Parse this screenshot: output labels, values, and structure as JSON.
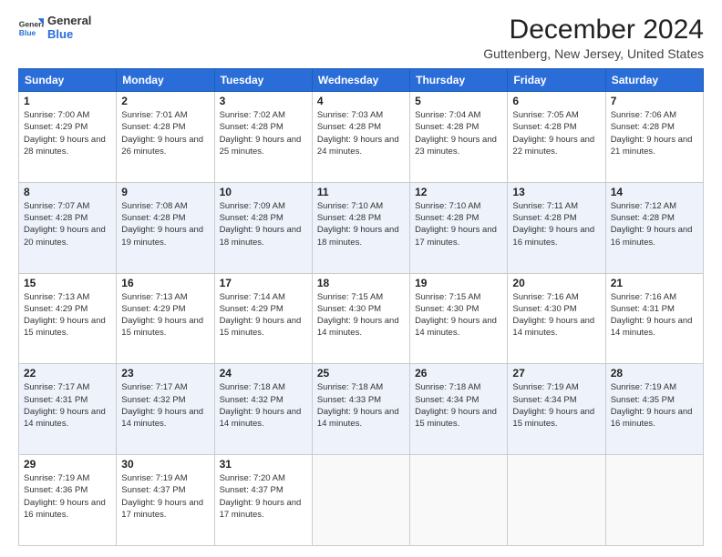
{
  "logo": {
    "text_general": "General",
    "text_blue": "Blue"
  },
  "header": {
    "title": "December 2024",
    "subtitle": "Guttenberg, New Jersey, United States"
  },
  "weekdays": [
    "Sunday",
    "Monday",
    "Tuesday",
    "Wednesday",
    "Thursday",
    "Friday",
    "Saturday"
  ],
  "weeks": [
    [
      {
        "day": "1",
        "sunrise": "7:00 AM",
        "sunset": "4:29 PM",
        "daylight": "9 hours and 28 minutes."
      },
      {
        "day": "2",
        "sunrise": "7:01 AM",
        "sunset": "4:28 PM",
        "daylight": "9 hours and 26 minutes."
      },
      {
        "day": "3",
        "sunrise": "7:02 AM",
        "sunset": "4:28 PM",
        "daylight": "9 hours and 25 minutes."
      },
      {
        "day": "4",
        "sunrise": "7:03 AM",
        "sunset": "4:28 PM",
        "daylight": "9 hours and 24 minutes."
      },
      {
        "day": "5",
        "sunrise": "7:04 AM",
        "sunset": "4:28 PM",
        "daylight": "9 hours and 23 minutes."
      },
      {
        "day": "6",
        "sunrise": "7:05 AM",
        "sunset": "4:28 PM",
        "daylight": "9 hours and 22 minutes."
      },
      {
        "day": "7",
        "sunrise": "7:06 AM",
        "sunset": "4:28 PM",
        "daylight": "9 hours and 21 minutes."
      }
    ],
    [
      {
        "day": "8",
        "sunrise": "7:07 AM",
        "sunset": "4:28 PM",
        "daylight": "9 hours and 20 minutes."
      },
      {
        "day": "9",
        "sunrise": "7:08 AM",
        "sunset": "4:28 PM",
        "daylight": "9 hours and 19 minutes."
      },
      {
        "day": "10",
        "sunrise": "7:09 AM",
        "sunset": "4:28 PM",
        "daylight": "9 hours and 18 minutes."
      },
      {
        "day": "11",
        "sunrise": "7:10 AM",
        "sunset": "4:28 PM",
        "daylight": "9 hours and 18 minutes."
      },
      {
        "day": "12",
        "sunrise": "7:10 AM",
        "sunset": "4:28 PM",
        "daylight": "9 hours and 17 minutes."
      },
      {
        "day": "13",
        "sunrise": "7:11 AM",
        "sunset": "4:28 PM",
        "daylight": "9 hours and 16 minutes."
      },
      {
        "day": "14",
        "sunrise": "7:12 AM",
        "sunset": "4:28 PM",
        "daylight": "9 hours and 16 minutes."
      }
    ],
    [
      {
        "day": "15",
        "sunrise": "7:13 AM",
        "sunset": "4:29 PM",
        "daylight": "9 hours and 15 minutes."
      },
      {
        "day": "16",
        "sunrise": "7:13 AM",
        "sunset": "4:29 PM",
        "daylight": "9 hours and 15 minutes."
      },
      {
        "day": "17",
        "sunrise": "7:14 AM",
        "sunset": "4:29 PM",
        "daylight": "9 hours and 15 minutes."
      },
      {
        "day": "18",
        "sunrise": "7:15 AM",
        "sunset": "4:30 PM",
        "daylight": "9 hours and 14 minutes."
      },
      {
        "day": "19",
        "sunrise": "7:15 AM",
        "sunset": "4:30 PM",
        "daylight": "9 hours and 14 minutes."
      },
      {
        "day": "20",
        "sunrise": "7:16 AM",
        "sunset": "4:30 PM",
        "daylight": "9 hours and 14 minutes."
      },
      {
        "day": "21",
        "sunrise": "7:16 AM",
        "sunset": "4:31 PM",
        "daylight": "9 hours and 14 minutes."
      }
    ],
    [
      {
        "day": "22",
        "sunrise": "7:17 AM",
        "sunset": "4:31 PM",
        "daylight": "9 hours and 14 minutes."
      },
      {
        "day": "23",
        "sunrise": "7:17 AM",
        "sunset": "4:32 PM",
        "daylight": "9 hours and 14 minutes."
      },
      {
        "day": "24",
        "sunrise": "7:18 AM",
        "sunset": "4:32 PM",
        "daylight": "9 hours and 14 minutes."
      },
      {
        "day": "25",
        "sunrise": "7:18 AM",
        "sunset": "4:33 PM",
        "daylight": "9 hours and 14 minutes."
      },
      {
        "day": "26",
        "sunrise": "7:18 AM",
        "sunset": "4:34 PM",
        "daylight": "9 hours and 15 minutes."
      },
      {
        "day": "27",
        "sunrise": "7:19 AM",
        "sunset": "4:34 PM",
        "daylight": "9 hours and 15 minutes."
      },
      {
        "day": "28",
        "sunrise": "7:19 AM",
        "sunset": "4:35 PM",
        "daylight": "9 hours and 16 minutes."
      }
    ],
    [
      {
        "day": "29",
        "sunrise": "7:19 AM",
        "sunset": "4:36 PM",
        "daylight": "9 hours and 16 minutes."
      },
      {
        "day": "30",
        "sunrise": "7:19 AM",
        "sunset": "4:37 PM",
        "daylight": "9 hours and 17 minutes."
      },
      {
        "day": "31",
        "sunrise": "7:20 AM",
        "sunset": "4:37 PM",
        "daylight": "9 hours and 17 minutes."
      },
      null,
      null,
      null,
      null
    ]
  ]
}
